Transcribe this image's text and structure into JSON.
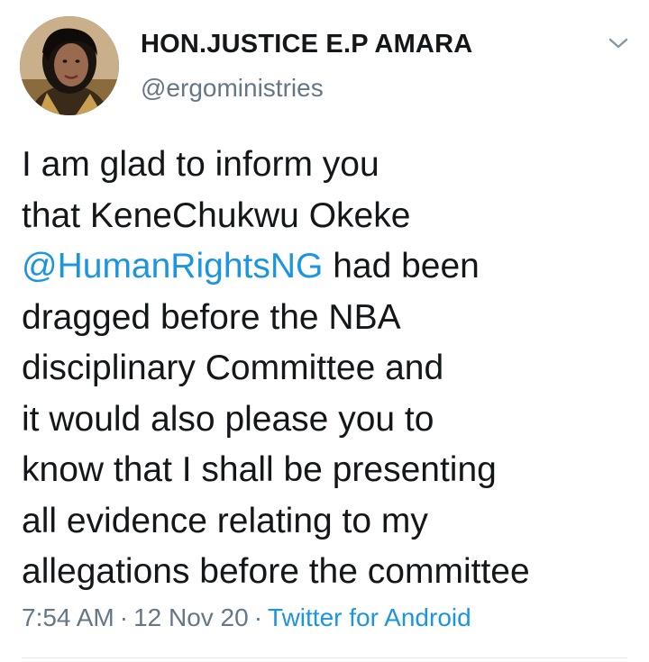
{
  "author": {
    "display_name": "HON.JUSTICE E.P AMARA",
    "handle": "@ergoministries"
  },
  "menu": {
    "icon": "chevron-down-icon"
  },
  "tweet": {
    "lines": {
      "l1": "I am glad to inform you",
      "l2": "that KeneChukwu Okeke",
      "l3_mention": "@HumanRightsNG",
      "l3_rest": " had been",
      "l4": "dragged before the NBA",
      "l5": "disciplinary Committee and",
      "l6": "it would also please you to",
      "l7": "know that I shall be presenting",
      "l8": "all evidence relating to my",
      "l9": "allegations before the committee"
    }
  },
  "meta": {
    "time": "7:54 AM",
    "date": "12 Nov 20",
    "separator": "·",
    "source": "Twitter for Android"
  },
  "colors": {
    "link": "#1b95e0",
    "secondary_text": "#657786",
    "primary_text": "#14171a"
  }
}
